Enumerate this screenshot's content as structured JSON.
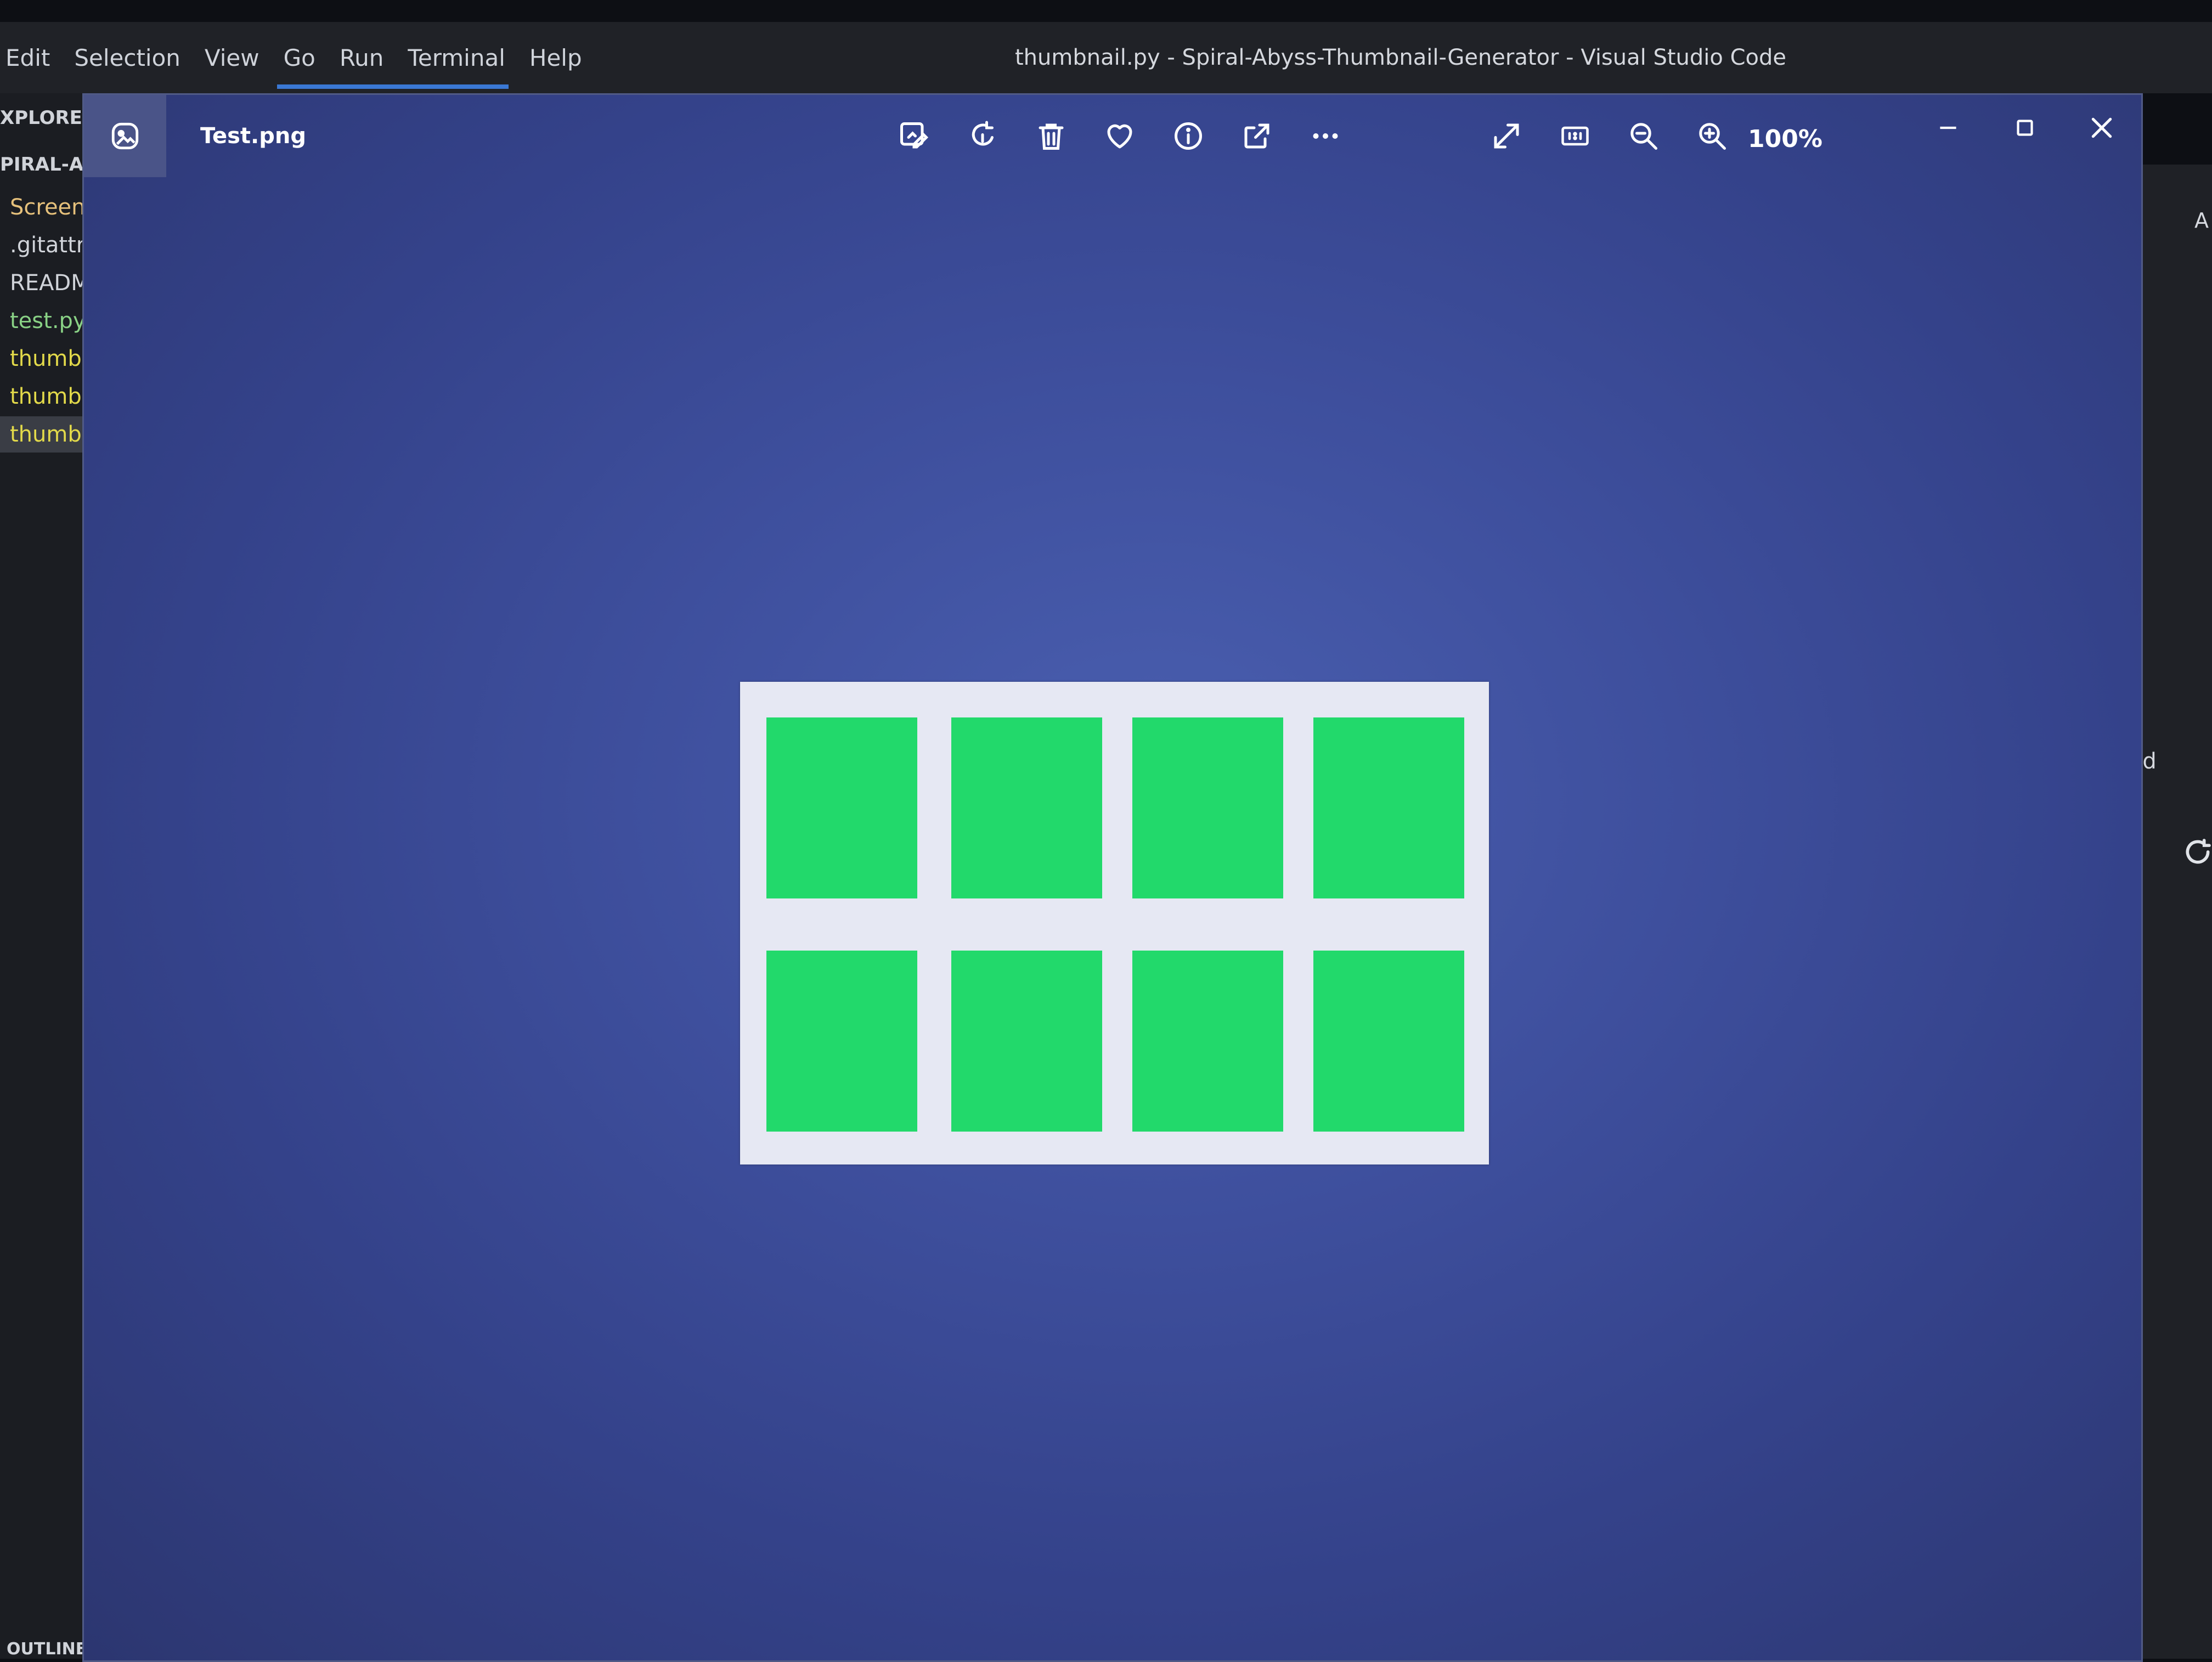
{
  "vscode": {
    "menu": [
      "Edit",
      "Selection",
      "View",
      "Go",
      "Run",
      "Terminal",
      "Help"
    ],
    "window_title": "thumbnail.py - Spiral-Abyss-Thumbnail-Generator - Visual Studio Code",
    "explorer": {
      "title": "XPLORER",
      "project": "PIRAL-AB",
      "files": [
        {
          "label": "Screens",
          "color": "#e5c07b"
        },
        {
          "label": ".gitattril",
          "color": "#d0d3d9"
        },
        {
          "label": "READM",
          "color": "#d0d3d9"
        },
        {
          "label": "test.py",
          "color": "#89d185"
        },
        {
          "label": "thumbr",
          "color": "#e2d94a"
        },
        {
          "label": "thumbr",
          "color": "#e2d94a"
        },
        {
          "label": "thumbr",
          "color": "#e2d94a",
          "active": true
        }
      ],
      "outline": "OUTLINE"
    },
    "right_panel": {
      "tab_label": "A",
      "find_label": "nd"
    }
  },
  "viewer": {
    "file_name": "Test.png",
    "zoom": "100%",
    "toolbar": [
      "edit-image-icon",
      "rotate-icon",
      "delete-icon",
      "favorite-heart-icon",
      "info-icon",
      "share-icon",
      "more-options-icon"
    ],
    "image": {
      "background": "#e6e8f3",
      "slot_color": "#22d96b",
      "rows": 2,
      "cols": 4
    }
  }
}
